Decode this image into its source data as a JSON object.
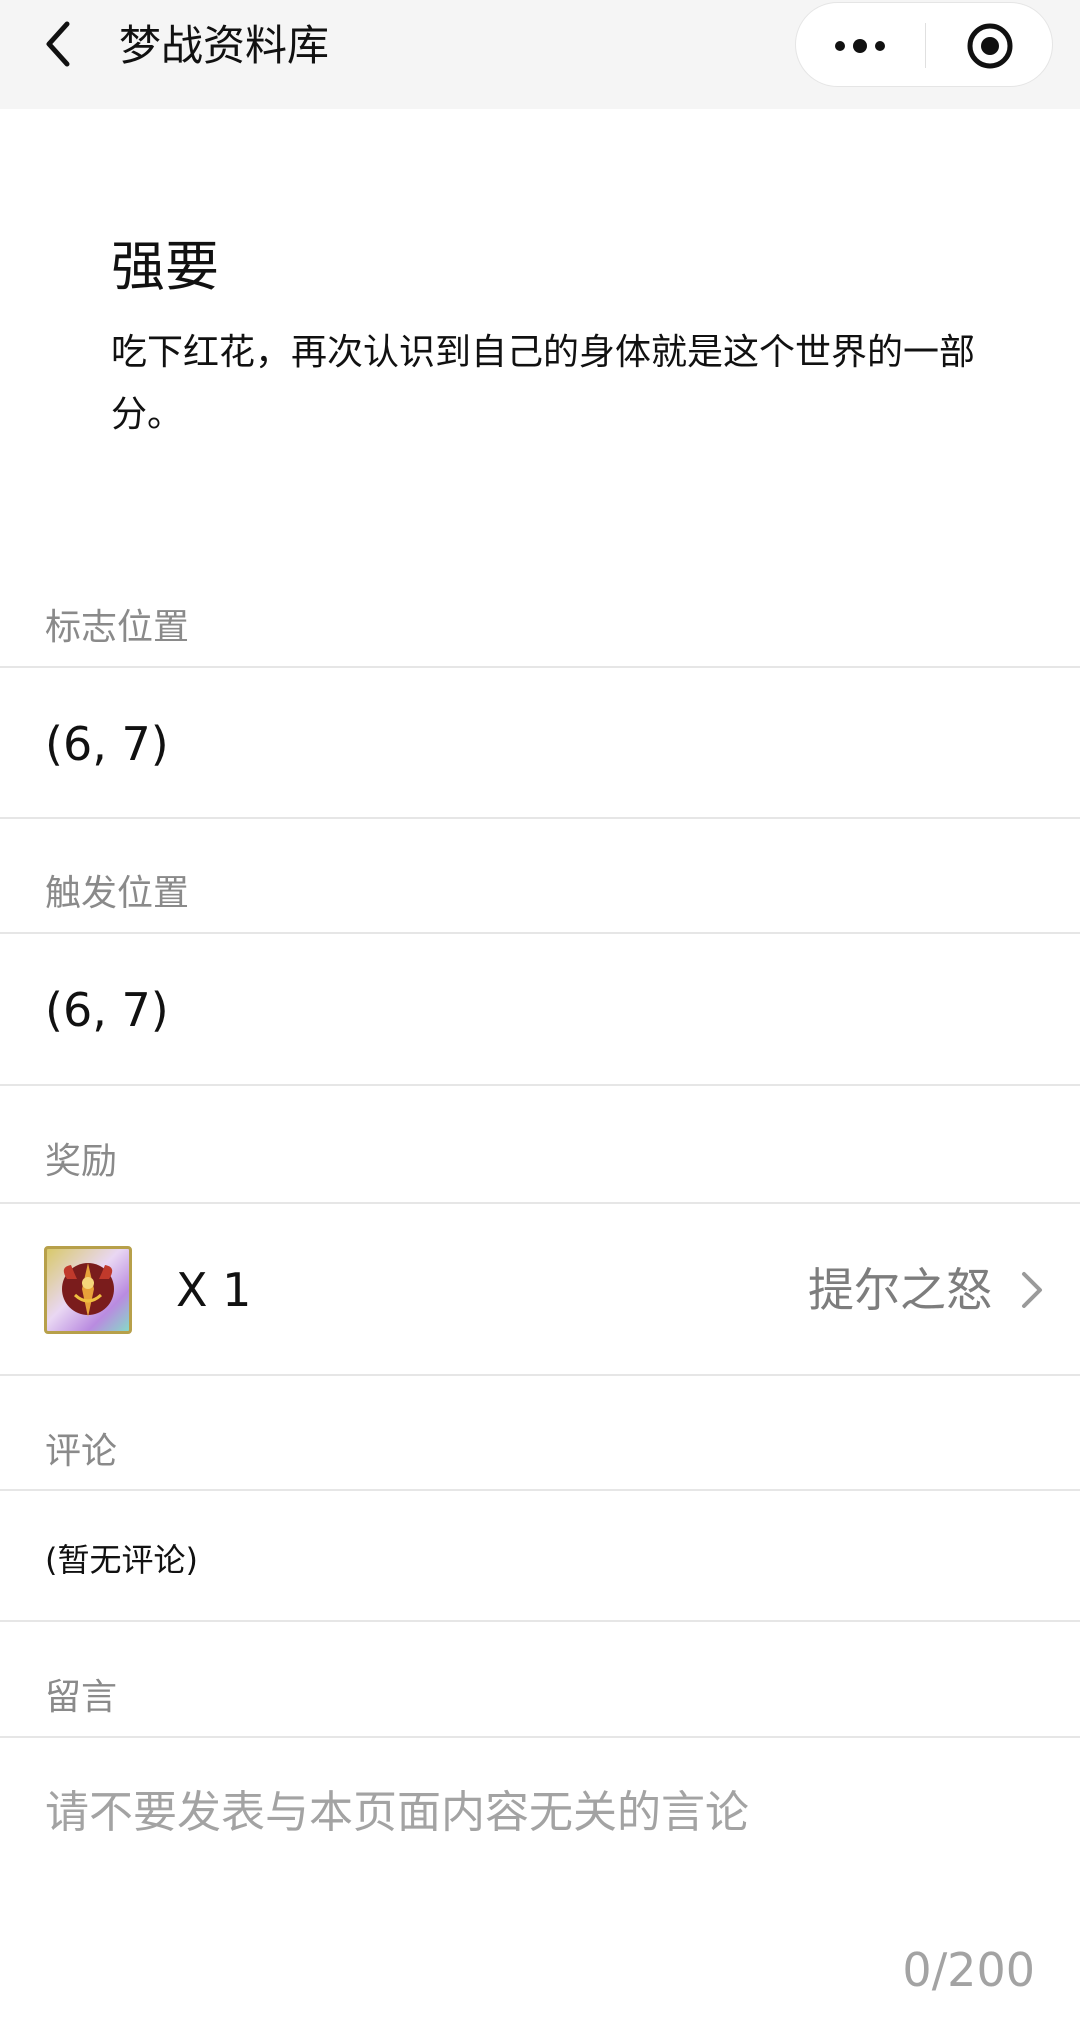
{
  "navbar": {
    "title": "梦战资料库",
    "back_icon": "chevron-left-icon",
    "more_icon": "more-dots-icon",
    "close_icon": "target-circle-icon"
  },
  "event": {
    "title": "强要",
    "description": "吃下红花，再次认识到自己的身体就是这个世界的一部分。"
  },
  "sections": {
    "flag_position": {
      "label": "标志位置",
      "value": "(6, 7)"
    },
    "trigger_position": {
      "label": "触发位置",
      "value": "(6, 7)"
    },
    "reward": {
      "label": "奖励",
      "icon": "reward-item-icon",
      "count": "X 1",
      "name": "提尔之怒"
    },
    "comments": {
      "label": "评论",
      "empty_text": "(暂无评论)"
    },
    "message": {
      "label": "留言",
      "placeholder": "请不要发表与本页面内容无关的言论",
      "value": "",
      "counter": "0/200"
    }
  },
  "colors": {
    "navbar_bg": "#f5f5f5",
    "label_gray": "#8a8a8a",
    "divider": "#e6e6e6",
    "placeholder": "#a3a3a3"
  }
}
